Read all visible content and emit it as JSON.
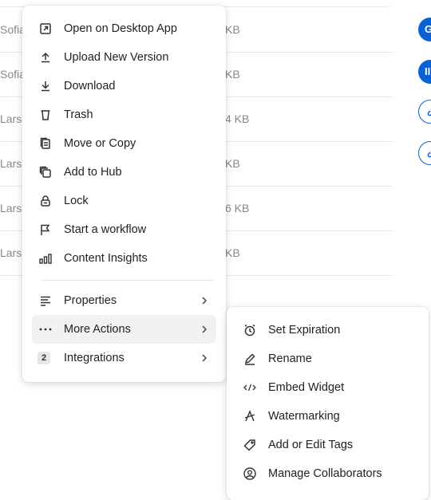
{
  "background_rows": [
    {
      "owner": "Sofia",
      "size": "KB"
    },
    {
      "owner": "Sofia",
      "size": "KB"
    },
    {
      "owner": "Lars",
      "size": "4 KB"
    },
    {
      "owner": "Lars",
      "size": "KB"
    },
    {
      "owner": "Lars",
      "size": "6 KB"
    },
    {
      "owner": "Lars",
      "size": "KB"
    }
  ],
  "avatars": [
    {
      "text": "G",
      "style": "solid"
    },
    {
      "text": "II",
      "style": "solid"
    },
    {
      "icon": "link-icon",
      "style": "outline"
    },
    {
      "icon": "link-icon",
      "style": "outline"
    }
  ],
  "context_menu": {
    "items": [
      {
        "label": "Open on Desktop App",
        "icon": "external-open-icon"
      },
      {
        "label": "Upload New Version",
        "icon": "upload-icon"
      },
      {
        "label": "Download",
        "icon": "download-icon"
      },
      {
        "label": "Trash",
        "icon": "trash-icon"
      },
      {
        "label": "Move or Copy",
        "icon": "copy-icon"
      },
      {
        "label": "Add to Hub",
        "icon": "hub-icon"
      },
      {
        "label": "Lock",
        "icon": "lock-icon"
      },
      {
        "label": "Start a workflow",
        "icon": "flag-icon"
      },
      {
        "label": "Content Insights",
        "icon": "bar-chart-icon"
      }
    ],
    "submenu_items": [
      {
        "label": "Properties",
        "icon": "list-icon"
      },
      {
        "label": "More Actions",
        "icon": "more-dots-icon",
        "active": true
      },
      {
        "label": "Integrations",
        "icon": "integrations-badge",
        "badge": "2"
      }
    ]
  },
  "more_actions_menu": {
    "items": [
      {
        "label": "Set Expiration",
        "icon": "alarm-clock-icon"
      },
      {
        "label": "Rename",
        "icon": "pencil-icon"
      },
      {
        "label": "Embed Widget",
        "icon": "code-icon"
      },
      {
        "label": "Watermarking",
        "icon": "watermark-icon"
      },
      {
        "label": "Add or Edit Tags",
        "icon": "tag-icon"
      },
      {
        "label": "Manage Collaborators",
        "icon": "collaborators-icon"
      }
    ]
  }
}
